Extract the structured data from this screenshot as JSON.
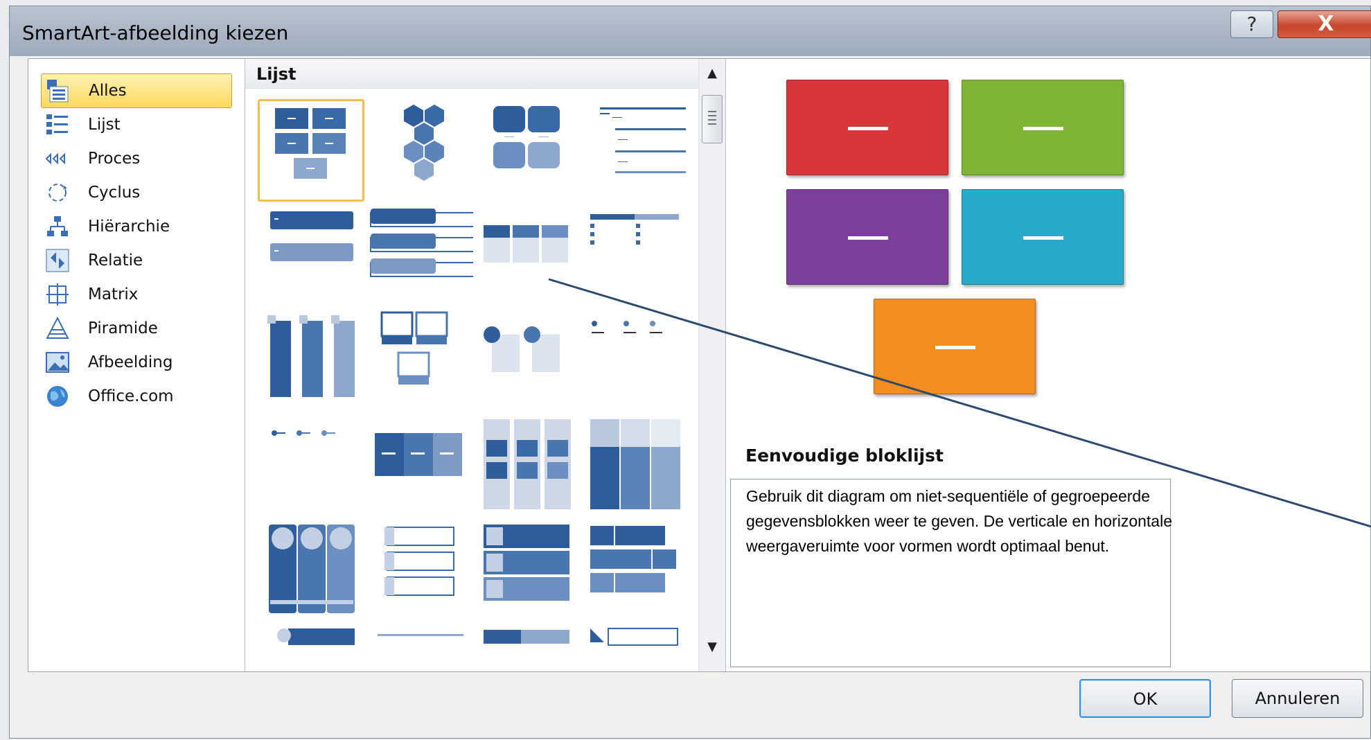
{
  "window": {
    "title": "SmartArt-afbeelding kiezen",
    "help_label": "?",
    "close_label": "X"
  },
  "categories": [
    {
      "label": "Alles",
      "icon": "all-icon",
      "selected": true
    },
    {
      "label": "Lijst",
      "icon": "list-icon",
      "selected": false
    },
    {
      "label": "Proces",
      "icon": "process-icon",
      "selected": false
    },
    {
      "label": "Cyclus",
      "icon": "cycle-icon",
      "selected": false
    },
    {
      "label": "Hiërarchie",
      "icon": "hierarchy-icon",
      "selected": false
    },
    {
      "label": "Relatie",
      "icon": "relationship-icon",
      "selected": false
    },
    {
      "label": "Matrix",
      "icon": "matrix-icon",
      "selected": false
    },
    {
      "label": "Piramide",
      "icon": "pyramid-icon",
      "selected": false
    },
    {
      "label": "Afbeelding",
      "icon": "picture-icon",
      "selected": false
    },
    {
      "label": "Office.com",
      "icon": "globe-icon",
      "selected": false
    }
  ],
  "gallery": {
    "title": "Lijst",
    "scroll_up": "▲",
    "scroll_down": "▼"
  },
  "preview": {
    "name": "Eenvoudige bloklijst",
    "description": "Gebruik dit diagram om niet-sequentiële of gegroepeerde gegevensblokken weer te geven. De verticale en horizontale weergaveruimte voor vormen wordt optimaal benut.",
    "block_colors": [
      "#d9363a",
      "#7fb533",
      "#7d3f9b",
      "#27a9c9",
      "#f28d1f"
    ]
  },
  "buttons": {
    "ok": "OK",
    "cancel": "Annuleren"
  },
  "colors": {
    "thumb_dark": "#2f5d9c",
    "thumb_light": "#8ea7cd",
    "selection_yellow": "#f0c04a"
  }
}
